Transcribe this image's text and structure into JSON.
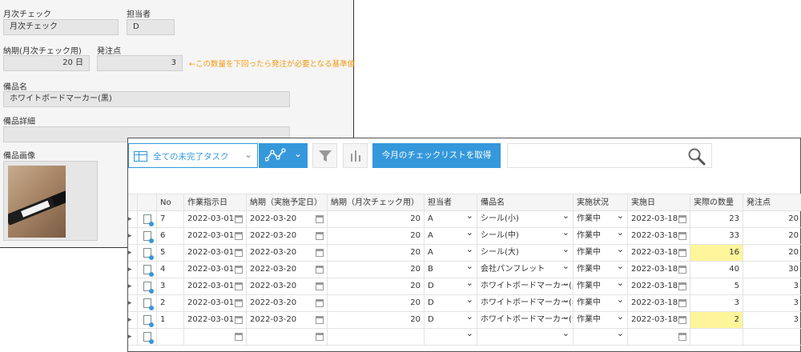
{
  "form": {
    "monthly_check_label": "月次チェック",
    "monthly_check_value": "月次チェック",
    "assignee_label": "担当者",
    "assignee_value": "D",
    "leadtime_label": "納期(月次チェック用)",
    "leadtime_value": "20 日",
    "reorder_label": "発注点",
    "reorder_value": "3",
    "reorder_note": "←この数量を下回ったら発注が必要となる基準値",
    "item_name_label": "備品名",
    "item_name_value": "ホワイトボードマーカー(黒)",
    "item_detail_label": "備品詳細",
    "item_detail_value": "",
    "item_image_label": "備品画像"
  },
  "toolbar": {
    "view_name": "全ての未完了タスク",
    "fetch_button": "今月のチェックリストを取得"
  },
  "table": {
    "headers": [
      "No",
      "作業指示日",
      "納期（実施予定日）",
      "納期（月次チェック用）",
      "担当者",
      "備品名",
      "実施状況",
      "実施日",
      "実際の数量",
      "発注点"
    ],
    "rows": [
      {
        "no": "7",
        "order_date": "2022-03-01",
        "due": "2022-03-20",
        "leadtime": "20",
        "assignee": "A",
        "item": "シール(小)",
        "status": "作業中",
        "done_date": "2022-03-18",
        "qty": "23",
        "reorder": "20",
        "highlight": false
      },
      {
        "no": "6",
        "order_date": "2022-03-01",
        "due": "2022-03-20",
        "leadtime": "20",
        "assignee": "A",
        "item": "シール(中)",
        "status": "作業中",
        "done_date": "2022-03-18",
        "qty": "33",
        "reorder": "20",
        "highlight": false
      },
      {
        "no": "5",
        "order_date": "2022-03-01",
        "due": "2022-03-20",
        "leadtime": "20",
        "assignee": "A",
        "item": "シール(大)",
        "status": "作業中",
        "done_date": "2022-03-18",
        "qty": "16",
        "reorder": "20",
        "highlight": true
      },
      {
        "no": "4",
        "order_date": "2022-03-01",
        "due": "2022-03-20",
        "leadtime": "20",
        "assignee": "B",
        "item": "会社パンフレット",
        "status": "作業中",
        "done_date": "2022-03-18",
        "qty": "40",
        "reorder": "30",
        "highlight": false
      },
      {
        "no": "3",
        "order_date": "2022-03-01",
        "due": "2022-03-20",
        "leadtime": "20",
        "assignee": "D",
        "item": "ホワイトボードマーカー(黒)",
        "status": "作業中",
        "done_date": "2022-03-18",
        "qty": "5",
        "reorder": "3",
        "highlight": false
      },
      {
        "no": "2",
        "order_date": "2022-03-01",
        "due": "2022-03-20",
        "leadtime": "20",
        "assignee": "D",
        "item": "ホワイトボードマーカー(赤)",
        "status": "作業中",
        "done_date": "2022-03-18",
        "qty": "3",
        "reorder": "3",
        "highlight": false
      },
      {
        "no": "1",
        "order_date": "2022-03-01",
        "due": "2022-03-20",
        "leadtime": "20",
        "assignee": "D",
        "item": "ホワイトボードマーカー(青)",
        "status": "作業中",
        "done_date": "2022-03-18",
        "qty": "2",
        "reorder": "3",
        "highlight": true
      }
    ]
  },
  "colors": {
    "accent": "#3498db",
    "highlight": "#fff59b",
    "note": "#f39c12"
  },
  "icons": [
    "table-icon",
    "graph-icon",
    "filter-icon",
    "bar-chart-icon",
    "search-icon",
    "calendar-icon",
    "record-detail-icon",
    "chevron-down-icon",
    "row-arrow-icon"
  ]
}
